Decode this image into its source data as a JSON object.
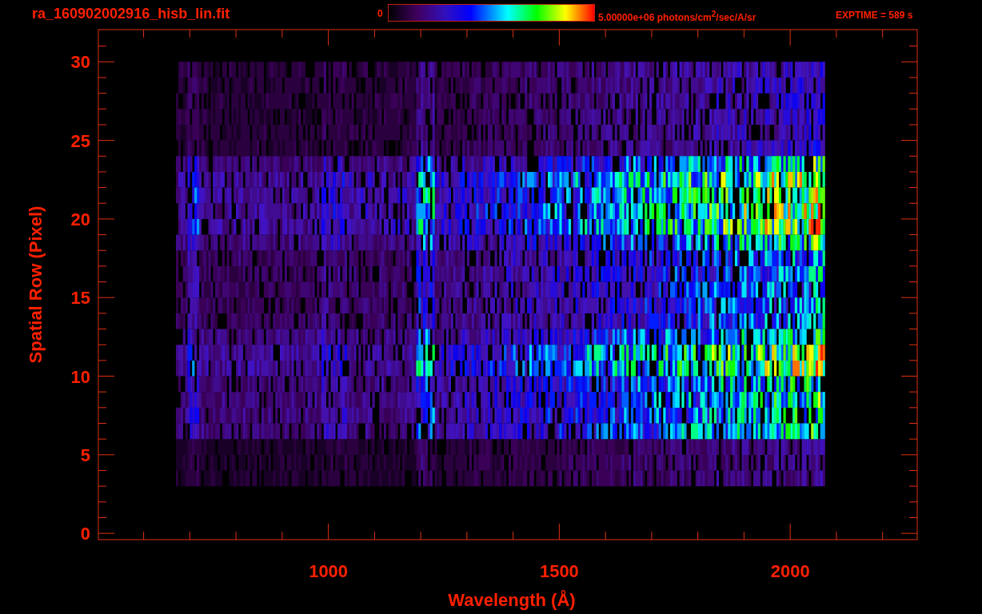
{
  "title": "ra_160902002916_hisb_lin.fit",
  "colorbar": {
    "min_label": "0",
    "max_label": "5.00000e+06 photons/cm$^{2}$/sec/A/sr"
  },
  "exptime": "EXPTIME = 589 s",
  "plot": {
    "xlabel": "Wavelength (Å)",
    "ylabel": "Spatial Row (Pixel)",
    "xticks": [
      "1000",
      "1500",
      "2000"
    ],
    "yticks": [
      "30",
      "25",
      "20",
      "15",
      "10",
      "5",
      "0"
    ]
  }
}
